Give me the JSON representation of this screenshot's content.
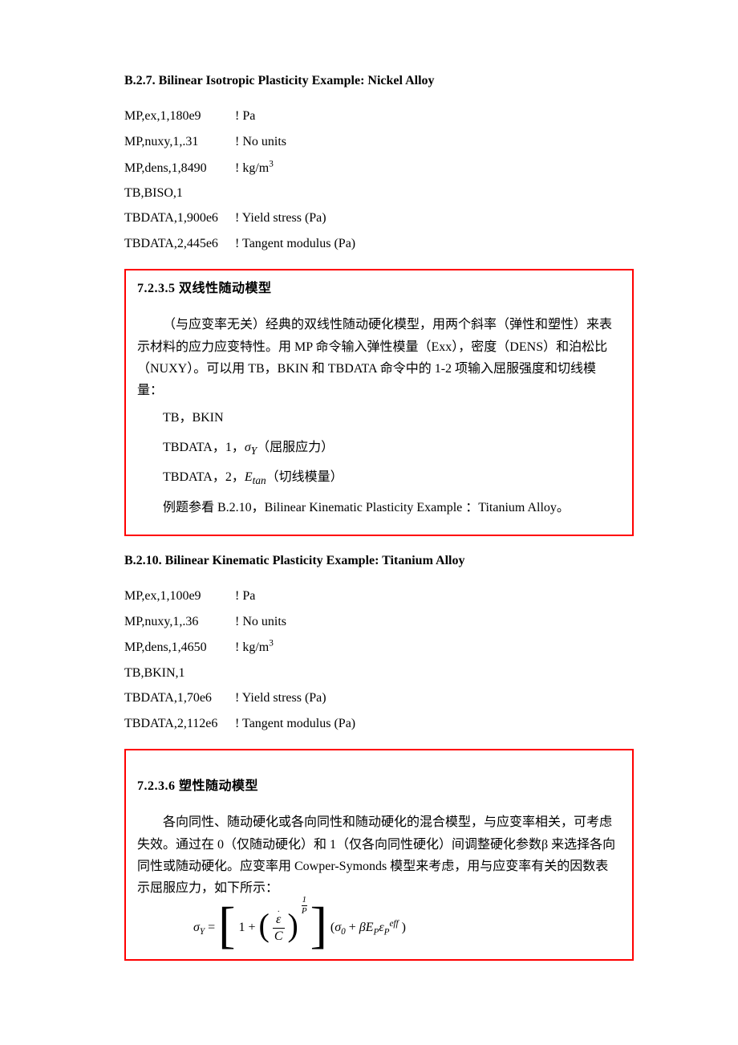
{
  "section1": {
    "heading": "B.2.7. Bilinear Isotropic Plasticity Example: Nickel Alloy",
    "lines": [
      {
        "cmd": "MP,ex,1,180e9",
        "comment": "! Pa"
      },
      {
        "cmd": "MP,nuxy,1,.31",
        "comment": "! No units"
      },
      {
        "cmd": "MP,dens,1,8490",
        "comment": "! kg/m",
        "sup": "3"
      },
      {
        "cmd": "TB,BISO,1",
        "comment": ""
      },
      {
        "cmd": "TBDATA,1,900e6",
        "comment": "! Yield stress (Pa)"
      },
      {
        "cmd": "TBDATA,2,445e6",
        "comment": "! Tangent modulus (Pa)"
      }
    ]
  },
  "box1": {
    "title": "7.2.3.5 双线性随动模型",
    "para": "（与应变率无关）经典的双线性随动硬化模型，用两个斜率（弹性和塑性）来表示材料的应力应变特性。用 MP 命令输入弹性模量（Exx），密度（DENS）和泊松比（NUXY）。可以用 TB，BKIN 和 TBDATA 命令中的 1-2 项输入屈服强度和切线模量：",
    "c1": "TB，BKIN",
    "c2a": "TBDATA，1，",
    "c2b": "σ",
    "c2sub": "Y",
    "c2c": "（屈服应力）",
    "c3a": "TBDATA，2，",
    "c3b": "E",
    "c3sub": "tan",
    "c3c": "（切线模量）",
    "ref": "例题参看 B.2.10，Bilinear Kinematic Plasticity Example ：Titanium Alloy。"
  },
  "section2": {
    "heading": "B.2.10. Bilinear Kinematic Plasticity Example: Titanium Alloy",
    "lines": [
      {
        "cmd": "MP,ex,1,100e9",
        "comment": "! Pa"
      },
      {
        "cmd": "MP,nuxy,1,.36",
        "comment": "! No units"
      },
      {
        "cmd": "MP,dens,1,4650",
        "comment": "! kg/m",
        "sup": "3"
      },
      {
        "cmd": "TB,BKIN,1",
        "comment": ""
      },
      {
        "cmd": "TBDATA,1,70e6",
        "comment": "! Yield stress (Pa)"
      },
      {
        "cmd": "TBDATA,2,112e6",
        "comment": "! Tangent modulus (Pa)"
      }
    ]
  },
  "box2": {
    "title": "7.2.3.6 塑性随动模型",
    "para": "各向同性、随动硬化或各向同性和随动硬化的混合模型，与应变率相关，可考虑失效。通过在 0（仅随动硬化）和 1（仅各向同性硬化）间调整硬化参数β 来选择各向同性或随动硬化。应变率用 Cowper-Symonds 模型来考虑，用与应变率有关的因数表示屈服应力，如下所示：",
    "eq": {
      "lhs_sym": "σ",
      "lhs_sub": "Y",
      "one": "1",
      "eps": "ε",
      "C": "C",
      "P": "P",
      "sigma0_sym": "σ",
      "sigma0_sub": "0",
      "beta": "β",
      "E": "E",
      "E_sub": "P",
      "eps2": "ε",
      "eps2_sub": "P",
      "eps2_sup": "eff"
    }
  }
}
